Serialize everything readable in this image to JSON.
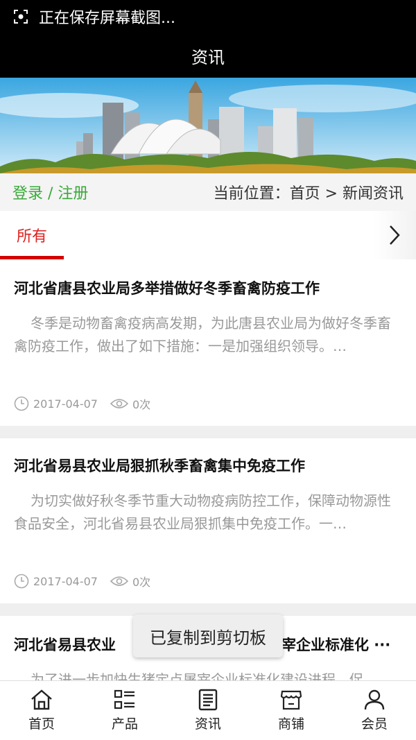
{
  "status_bar": {
    "text": "正在保存屏幕截图..."
  },
  "header": {
    "title": "资讯"
  },
  "userbar": {
    "auth": "登录 / 注册",
    "breadcrumb": "当前位置：首页 > 新闻资讯"
  },
  "tabs": {
    "active": "所有"
  },
  "articles": [
    {
      "title": "河北省唐县农业局多举措做好冬季畜禽防疫工作",
      "summary": "冬季是动物畜禽疫病高发期，为此唐县农业局为做好冬季畜禽防疫工作，做出了如下措施：一是加强组织领导。…",
      "date": "2017-04-07",
      "views": "0次"
    },
    {
      "title": "河北省易县农业局狠抓秋季畜禽集中免疫工作",
      "summary": "为切实做好秋冬季节重大动物疫病防控工作，保障动物源性食品安全，河北省易县农业局狠抓集中免疫工作。一…",
      "date": "2017-04-07",
      "views": "0次"
    },
    {
      "title_left": "河北省易县农业",
      "title_right": "宰企业标准化 ···",
      "summary_partial": "为了进一步加快生猪定点屠宰企业标准化建设进程，促"
    }
  ],
  "toast": {
    "text": "已复制到剪切板"
  },
  "bottom_nav": [
    {
      "label": "首页",
      "icon": "home-icon"
    },
    {
      "label": "产品",
      "icon": "product-list-icon"
    },
    {
      "label": "资讯",
      "icon": "news-icon"
    },
    {
      "label": "商铺",
      "icon": "shop-icon"
    },
    {
      "label": "会员",
      "icon": "member-icon"
    }
  ],
  "colors": {
    "accent_red": "#d40000",
    "auth_green": "#3aa93a",
    "header_bg": "#000000"
  }
}
